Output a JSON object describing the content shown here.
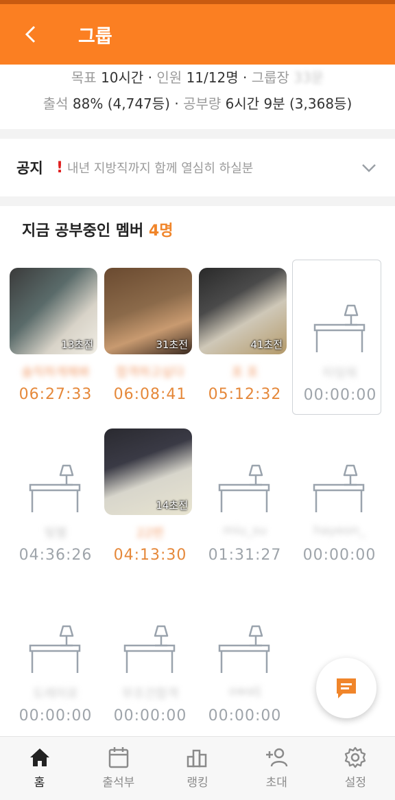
{
  "header": {
    "title": "그룹"
  },
  "stats": {
    "line1": {
      "goal_label": "목표",
      "goal_value": "10시간",
      "members_label": "인원",
      "members_value": "11/12명",
      "leader_label": "그룹장",
      "leader_value": "33문"
    },
    "line2": {
      "attendance_label": "출석",
      "attendance_value": "88% (4,747등)",
      "study_label": "공부량",
      "study_value": "6시간 9분 (3,368등)"
    }
  },
  "notice": {
    "label": "공지",
    "text": "내년 지방직까지 함께 열심히 하실분"
  },
  "studying": {
    "title": "지금 공부중인 멤버",
    "count": "4명"
  },
  "members": [
    {
      "name": "솔직하게해봐",
      "time": "06:27:33",
      "active": true,
      "photo": true,
      "ago": "13초전"
    },
    {
      "name": "합격하고싶다",
      "time": "06:08:41",
      "active": true,
      "photo": true,
      "ago": "31초전"
    },
    {
      "name": "포 포",
      "time": "05:12:32",
      "active": true,
      "photo": true,
      "ago": "41초전"
    },
    {
      "name": "타임워",
      "time": "00:00:00",
      "active": false,
      "photo": false,
      "selected": true
    },
    {
      "name": "빛별",
      "time": "04:36:26",
      "active": false,
      "photo": false
    },
    {
      "name": "22번",
      "time": "04:13:30",
      "active": true,
      "photo": true,
      "ago": "14초전"
    },
    {
      "name": "miu_su",
      "time": "01:31:27",
      "active": false,
      "photo": false
    },
    {
      "name": "hayeon_",
      "time": "00:00:00",
      "active": false,
      "photo": false
    },
    {
      "name": "도레미로",
      "time": "00:00:00",
      "active": false,
      "photo": false
    },
    {
      "name": "무조건합격",
      "time": "00:00:00",
      "active": false,
      "photo": false
    },
    {
      "name": "owalj",
      "time": "00:00:00",
      "active": false,
      "photo": false
    }
  ],
  "tabs": [
    {
      "label": "홈",
      "icon": "home-icon",
      "active": true
    },
    {
      "label": "출석부",
      "icon": "calendar-icon",
      "active": false
    },
    {
      "label": "랭킹",
      "icon": "ranking-icon",
      "active": false
    },
    {
      "label": "초대",
      "icon": "invite-icon",
      "active": false
    },
    {
      "label": "설정",
      "icon": "settings-icon",
      "active": false
    }
  ],
  "colors": {
    "accent": "#fb7f22",
    "active_time": "#e5883a",
    "idle_time": "#9ea4aa"
  }
}
